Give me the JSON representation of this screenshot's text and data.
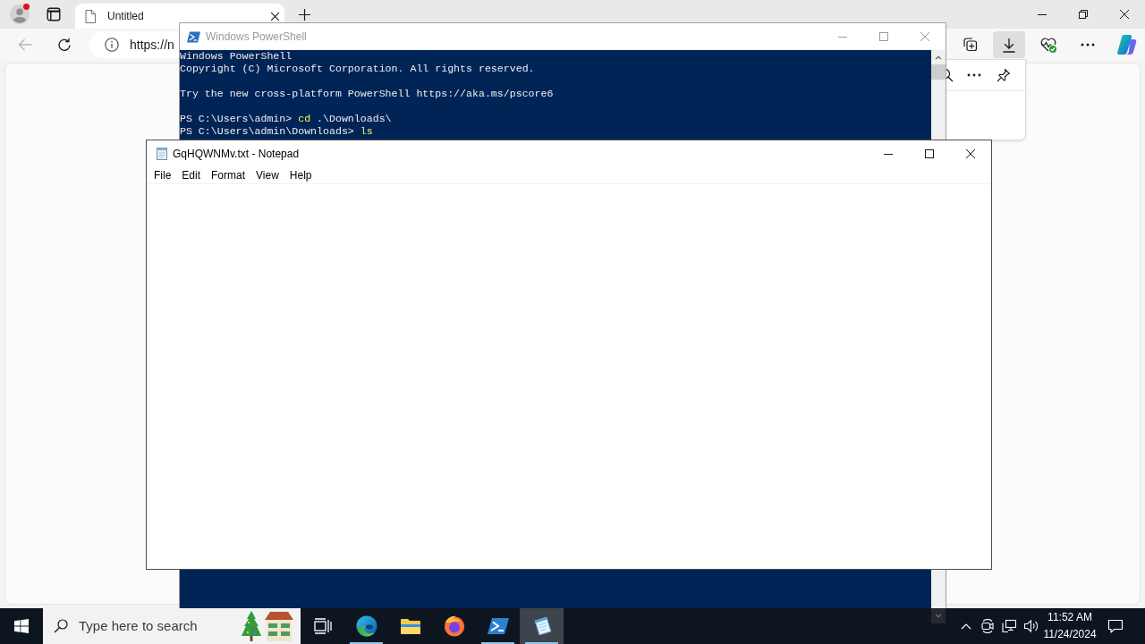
{
  "browser": {
    "profile": {
      "notification": true
    },
    "tabs": [
      {
        "title": "Untitled",
        "selected": true
      }
    ],
    "back_button": {
      "disabled": true
    },
    "address": "https://n",
    "toolbar": [
      {
        "kind": "collections",
        "selected": false
      },
      {
        "kind": "downloads",
        "selected": true
      },
      {
        "kind": "essentials",
        "selected": false
      },
      {
        "kind": "more",
        "selected": false
      },
      {
        "kind": "copilot",
        "selected": false
      }
    ],
    "downloads_panel": {
      "actions": [
        {
          "kind": "search"
        },
        {
          "kind": "more"
        },
        {
          "kind": "pin"
        }
      ]
    }
  },
  "powershell": {
    "title": "Windows PowerShell",
    "active": false,
    "banner": [
      "Windows PowerShell",
      "Copyright (C) Microsoft Corporation. All rights reserved."
    ],
    "hint": "Try the new cross-platform PowerShell https://aka.ms/pscore6",
    "history": [
      {
        "prompt": "PS C:\\Users\\admin>",
        "command": "cd",
        "argument": ".\\Downloads\\"
      },
      {
        "prompt": "PS C:\\Users\\admin\\Downloads>",
        "command": "ls"
      }
    ]
  },
  "notepad": {
    "title": "GqHQWNMv.txt - Notepad",
    "active": true,
    "menu": [
      "File",
      "Edit",
      "Format",
      "View",
      "Help"
    ]
  },
  "taskbar": {
    "search": {
      "placeholder": "Type here to search"
    },
    "apps": [
      {
        "kind": "task-view",
        "running": false,
        "selected": false
      },
      {
        "kind": "edge",
        "running": true,
        "selected": false
      },
      {
        "kind": "explorer",
        "running": false,
        "selected": false
      },
      {
        "kind": "firefox",
        "running": false,
        "selected": false
      },
      {
        "kind": "powershell",
        "running": true,
        "selected": false
      },
      {
        "kind": "notepad",
        "running": true,
        "selected": true
      }
    ],
    "clock": {
      "time": "11:52 AM",
      "date": "11/24/2024"
    }
  }
}
